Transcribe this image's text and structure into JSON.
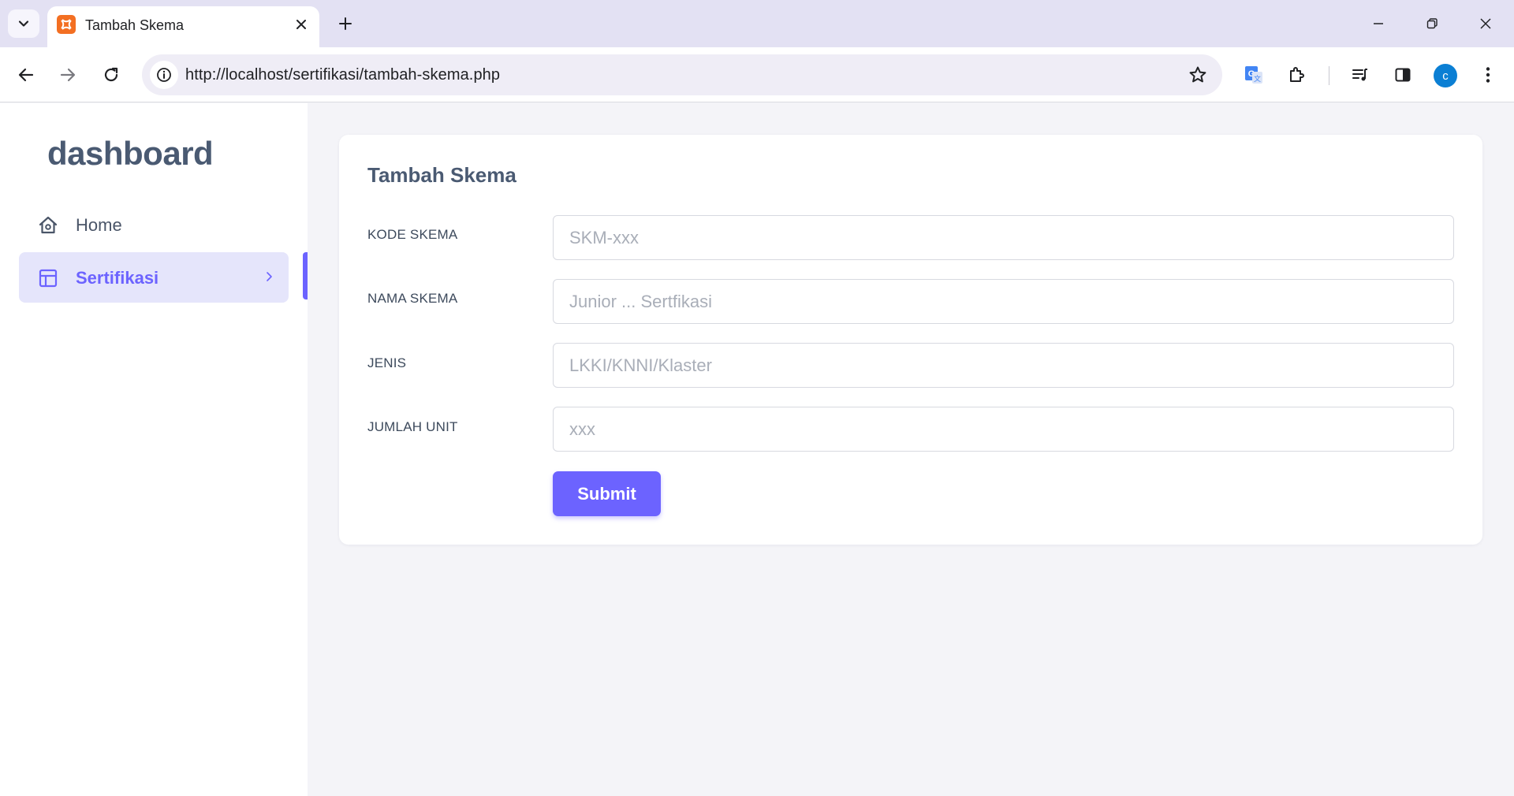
{
  "browser": {
    "tab_title": "Tambah Skema",
    "url": "http://localhost/sertifikasi/tambah-skema.php",
    "avatar_initial": "c"
  },
  "sidebar": {
    "brand": "dashboard",
    "items": [
      {
        "label": "Home",
        "icon": "home-icon",
        "active": false
      },
      {
        "label": "Sertifikasi",
        "icon": "layout-icon",
        "active": true
      }
    ]
  },
  "form": {
    "title": "Tambah Skema",
    "fields": [
      {
        "label": "KODE SKEMA",
        "placeholder": "SKM-xxx",
        "value": ""
      },
      {
        "label": "NAMA SKEMA",
        "placeholder": "Junior ... Sertfikasi",
        "value": ""
      },
      {
        "label": "JENIS",
        "placeholder": "LKKI/KNNI/Klaster",
        "value": ""
      },
      {
        "label": "JUMLAH UNIT",
        "placeholder": "xxx",
        "value": ""
      }
    ],
    "submit_label": "Submit"
  },
  "colors": {
    "accent": "#6c63ff",
    "active_bg": "#e5e5fb",
    "brand_text": "#4a5a72",
    "page_bg": "#f4f4f8",
    "tabstrip_bg": "#e3e1f3"
  }
}
